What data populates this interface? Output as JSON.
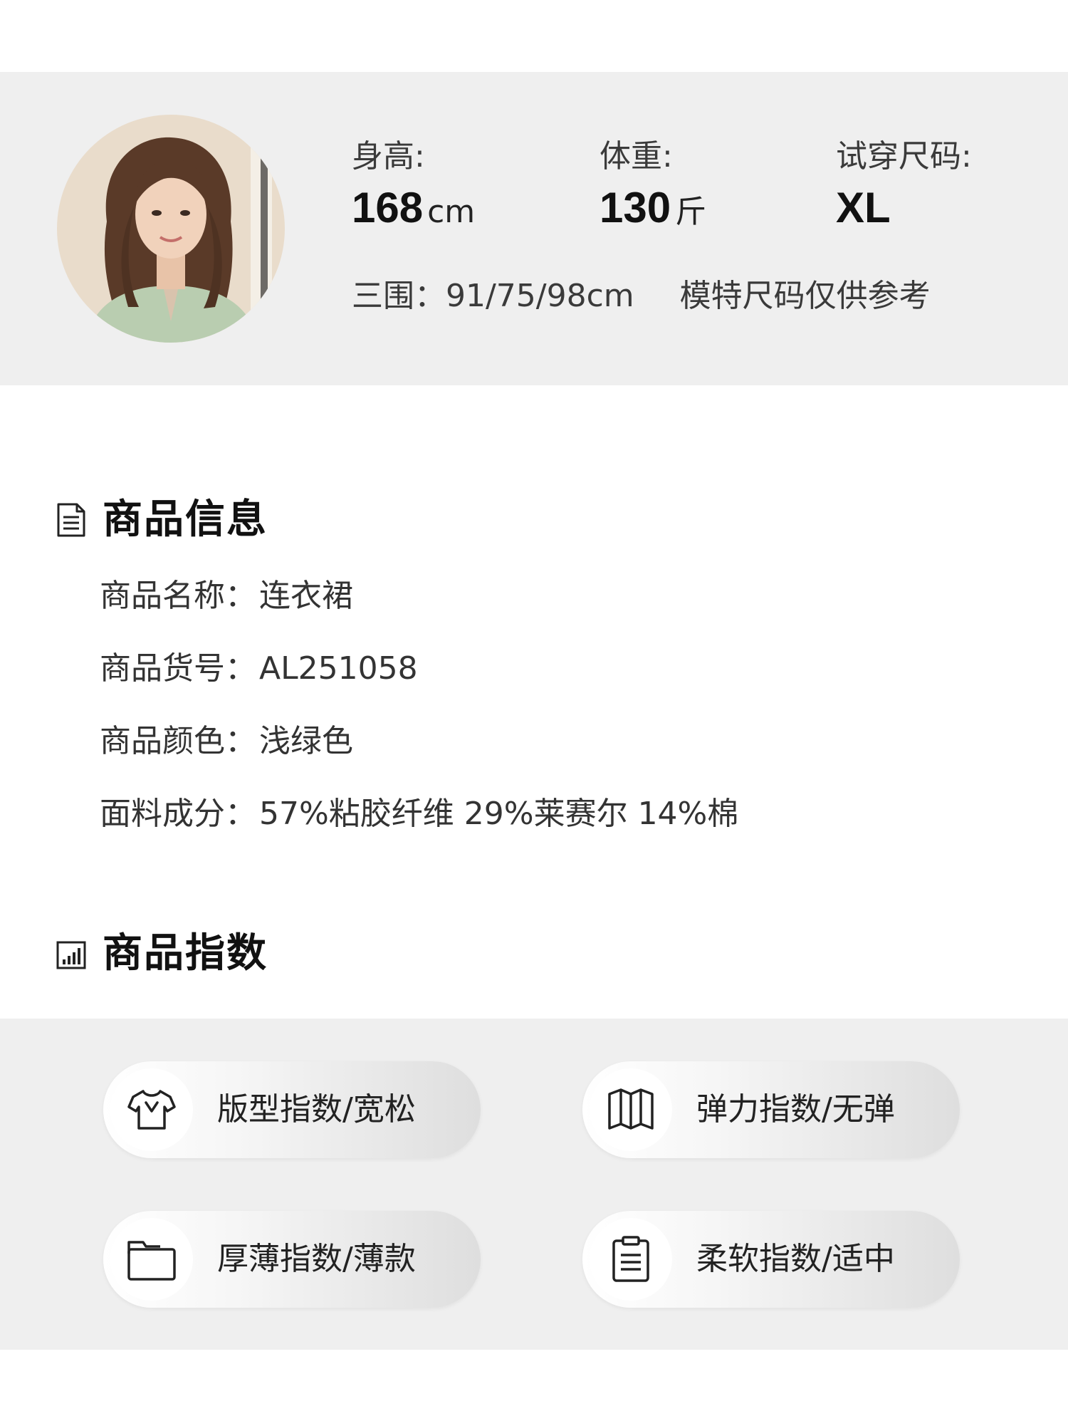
{
  "model": {
    "height": {
      "label": "身高:",
      "value": "168",
      "unit": "cm"
    },
    "weight": {
      "label": "体重:",
      "value": "130",
      "unit": "斤"
    },
    "size": {
      "label": "试穿尺码:",
      "value": "XL"
    },
    "measurements": "三围：91/75/98cm",
    "note": "模特尺码仅供参考"
  },
  "product_info": {
    "title": "商品信息",
    "rows": [
      {
        "label": "商品名称：",
        "value": "连衣裙"
      },
      {
        "label": "商品货号：",
        "value": "AL251058"
      },
      {
        "label": "商品颜色：",
        "value": "浅绿色"
      },
      {
        "label": "面料成分：",
        "value": "57%粘胶纤维 29%莱赛尔 14%棉"
      }
    ]
  },
  "product_index": {
    "title": "商品指数",
    "items": [
      {
        "icon": "tshirt-icon",
        "label": "版型指数/宽松"
      },
      {
        "icon": "map-fold-icon",
        "label": "弹力指数/无弹"
      },
      {
        "icon": "folder-icon",
        "label": "厚薄指数/薄款"
      },
      {
        "icon": "clipboard-icon",
        "label": "柔软指数/适中"
      }
    ]
  },
  "colors": {
    "panel_bg": "#efefef",
    "garment": "#b9cdb0",
    "text": "#2a2a2a"
  }
}
